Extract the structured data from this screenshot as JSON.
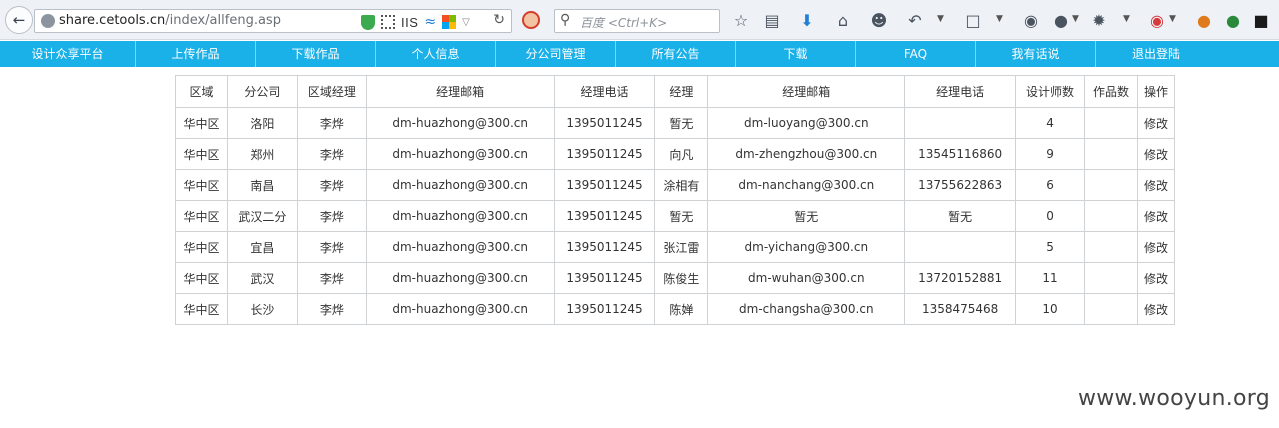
{
  "browser": {
    "url_domain": "share.cetools.cn",
    "url_path": "/index/allfeng.asp",
    "addon_label": "IIS",
    "search_placeholder": "百度 <Ctrl+K>"
  },
  "nav": {
    "items": [
      {
        "label": "设计众享平台"
      },
      {
        "label": "上传作品"
      },
      {
        "label": "下载作品"
      },
      {
        "label": "个人信息"
      },
      {
        "label": "分公司管理"
      },
      {
        "label": "所有公告"
      },
      {
        "label": "下载"
      },
      {
        "label": "FAQ"
      },
      {
        "label": "我有话说"
      },
      {
        "label": "退出登陆"
      }
    ]
  },
  "table": {
    "headers": [
      "区域",
      "分公司",
      "区域经理",
      "经理邮箱",
      "经理电话",
      "经理",
      "经理邮箱",
      "经理电话",
      "设计师数",
      "作品数",
      "操作"
    ],
    "rows": [
      [
        "华中区",
        "洛阳",
        "李烨",
        "dm-huazhong@300.cn",
        "1395011245",
        "暂无",
        "dm-luoyang@300.cn",
        "",
        "4",
        "",
        "修改"
      ],
      [
        "华中区",
        "郑州",
        "李烨",
        "dm-huazhong@300.cn",
        "1395011245",
        "向凡",
        "dm-zhengzhou@300.cn",
        "13545116860",
        "9",
        "",
        "修改"
      ],
      [
        "华中区",
        "南昌",
        "李烨",
        "dm-huazhong@300.cn",
        "1395011245",
        "涂相有",
        "dm-nanchang@300.cn",
        "13755622863",
        "6",
        "",
        "修改"
      ],
      [
        "华中区",
        "武汉二分",
        "李烨",
        "dm-huazhong@300.cn",
        "1395011245",
        "暂无",
        "暂无",
        "暂无",
        "0",
        "",
        "修改"
      ],
      [
        "华中区",
        "宜昌",
        "李烨",
        "dm-huazhong@300.cn",
        "1395011245",
        "张江雷",
        "dm-yichang@300.cn",
        "",
        "5",
        "",
        "修改"
      ],
      [
        "华中区",
        "武汉",
        "李烨",
        "dm-huazhong@300.cn",
        "1395011245",
        "陈俊生",
        "dm-wuhan@300.cn",
        "13720152881",
        "11",
        "",
        "修改"
      ],
      [
        "华中区",
        "长沙",
        "李烨",
        "dm-huazhong@300.cn",
        "1395011245",
        "陈婵",
        "dm-changsha@300.cn",
        "1358475468",
        "10",
        "",
        "修改"
      ]
    ]
  },
  "watermark": "www.wooyun.org",
  "colors": {
    "nav_bg": "#1ab0e8",
    "nav_text": "#ffffff",
    "table_border": "#cfd3d6",
    "toolbar_bg": "#eef1f5"
  }
}
